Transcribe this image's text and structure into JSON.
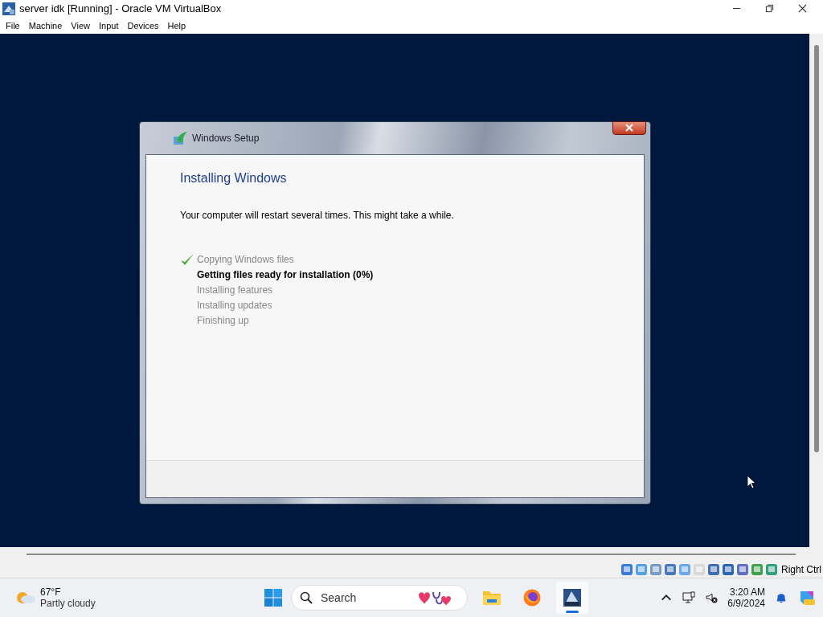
{
  "window": {
    "title": "server idk [Running] - Oracle VM VirtualBox"
  },
  "menu": [
    "File",
    "Machine",
    "View",
    "Input",
    "Devices",
    "Help"
  ],
  "setup_dialog": {
    "title": "Windows Setup",
    "heading": "Installing Windows",
    "message": "Your computer will restart several times. This might take a while.",
    "steps": [
      {
        "label": "Copying Windows files",
        "completed": true,
        "current": false
      },
      {
        "label": "Getting files ready for installation (0%)",
        "completed": false,
        "current": true
      },
      {
        "label": "Installing features",
        "completed": false,
        "current": false
      },
      {
        "label": "Installing updates",
        "completed": false,
        "current": false
      },
      {
        "label": "Finishing up",
        "completed": false,
        "current": false
      }
    ]
  },
  "status_bar": {
    "host_key": "Right Ctrl"
  },
  "taskbar": {
    "weather": {
      "temperature": "67°F",
      "condition": "Partly cloudy"
    },
    "search": {
      "placeholder": "Search"
    },
    "apps": [
      {
        "kind": "files",
        "active": false
      },
      {
        "kind": "browser",
        "active": false
      },
      {
        "kind": "virtualbox",
        "active": true
      }
    ],
    "clock": {
      "time": "3:20 AM",
      "date": "6/9/2024"
    }
  }
}
